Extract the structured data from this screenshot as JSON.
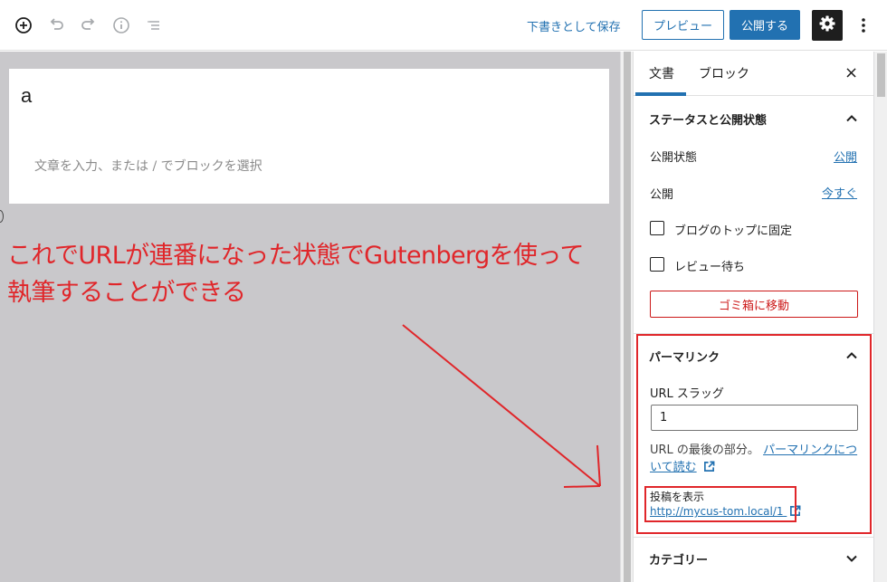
{
  "toolbar": {
    "icons": [
      "add-block-icon",
      "undo-icon",
      "redo-icon",
      "info-icon",
      "list-view-icon",
      "gear-icon",
      "more-vertical-icon"
    ],
    "save_draft": "下書きとして保存",
    "preview": "プレビュー",
    "publish": "公開する"
  },
  "editor": {
    "title": "a",
    "placeholder": "文章を入力、または / でブロックを選択",
    "annotation_line1": "これでURLが連番になった状態でGutenbergを使って",
    "annotation_line2": "執筆することができる",
    "annotation_color": "#e0262a"
  },
  "sidebar": {
    "tabs": [
      {
        "label": "文書",
        "active": true
      },
      {
        "label": "ブロック",
        "active": false
      }
    ],
    "close": "×",
    "status_panel": {
      "title": "ステータスと公開状態",
      "visibility_label": "公開状態",
      "visibility_value": "公開",
      "publish_label": "公開",
      "publish_value": "今すぐ",
      "sticky_label": "ブログのトップに固定",
      "pending_label": "レビュー待ち",
      "trash_label": "ゴミ箱に移動"
    },
    "permalink_panel": {
      "title": "パーマリンク",
      "slug_label": "URL スラッグ",
      "slug_value": "1",
      "help_prefix": "URL の最後の部分。",
      "help_link": "パーマリンクについて読む",
      "view_label": "投稿を表示",
      "view_url": "http://mycus-tom.local/1"
    },
    "category_panel": {
      "title": "カテゴリー"
    }
  },
  "colors": {
    "accent": "#2271b1",
    "danger": "#cc1818",
    "annotation": "#e0262a",
    "editor_bg": "#c9c8cb"
  }
}
